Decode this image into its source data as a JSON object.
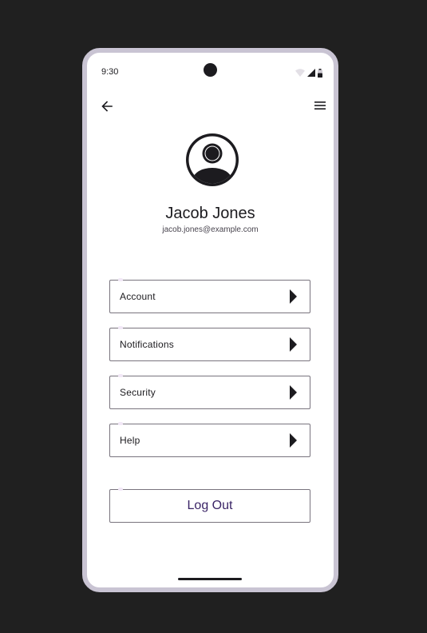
{
  "status_bar": {
    "time": "9:30",
    "icons": [
      "wifi-icon",
      "signal-icon",
      "battery-icon"
    ]
  },
  "top_bar": {
    "back_icon": "arrow-back-icon",
    "menu_icon": "hamburger-menu-icon"
  },
  "profile": {
    "avatar_icon": "account-circle-icon",
    "name": "Jacob Jones",
    "email": "jacob.jones@example.com"
  },
  "menu": {
    "items": [
      {
        "label": "Account",
        "icon": "play-arrow-icon"
      },
      {
        "label": "Notifications",
        "icon": "play-arrow-icon"
      },
      {
        "label": "Security",
        "icon": "play-arrow-icon"
      },
      {
        "label": "Help",
        "icon": "play-arrow-icon"
      }
    ]
  },
  "logout": {
    "label": "Log Out"
  },
  "colors": {
    "background": "#202020",
    "frame": "#c9c4d3",
    "text": "#1c1b1f",
    "outline": "#79747e",
    "logout_text": "#3a2466"
  }
}
